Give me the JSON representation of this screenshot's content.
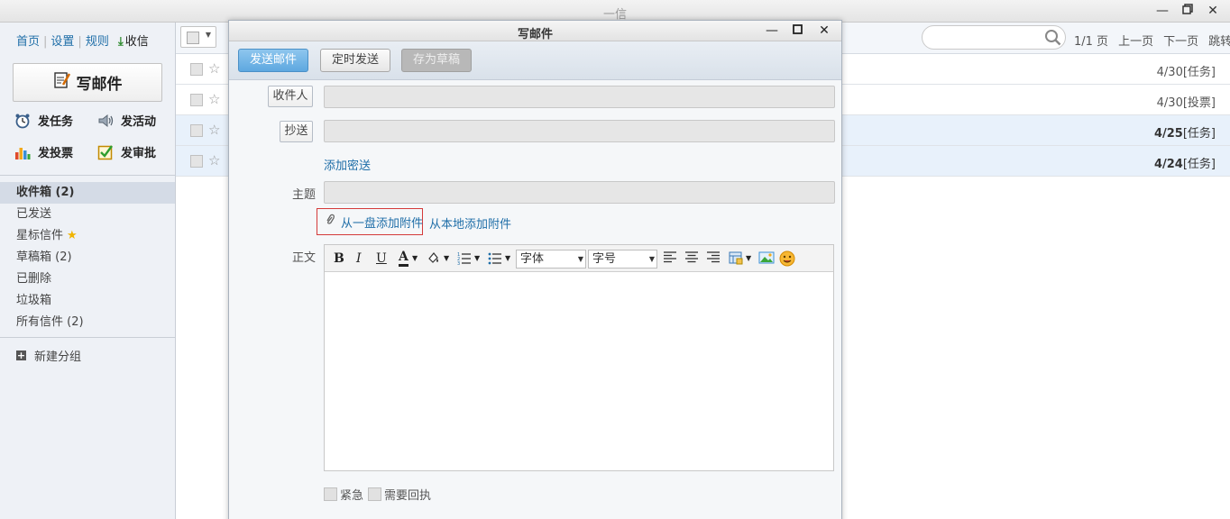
{
  "window": {
    "title": "一信"
  },
  "sidebar": {
    "toplinks": [
      "首页",
      "设置",
      "规则"
    ],
    "receive_label": "收信",
    "compose_label": "写邮件",
    "quick_actions": [
      {
        "label": "发任务",
        "icon": "alarm-clock-icon"
      },
      {
        "label": "发活动",
        "icon": "speaker-icon"
      },
      {
        "label": "发投票",
        "icon": "bar-chart-icon"
      },
      {
        "label": "发审批",
        "icon": "checkbox-check-icon"
      }
    ],
    "folders": [
      {
        "label": "收件箱 (2)",
        "active": true
      },
      {
        "label": "已发送"
      },
      {
        "label": "星标信件"
      },
      {
        "label": "草稿箱 (2)"
      },
      {
        "label": "已删除"
      },
      {
        "label": "垃圾箱"
      },
      {
        "label": "所有信件 (2)"
      }
    ],
    "new_group_label": "新建分组"
  },
  "list": {
    "pager": {
      "page_info": "1/1 页",
      "prev": "上一页",
      "next": "下一页",
      "jump": "跳转"
    },
    "rows": [
      {
        "date": "4/30",
        "tag": "[任务]",
        "unread": false
      },
      {
        "date": "4/30",
        "tag": "[投票]",
        "unread": false
      },
      {
        "date": "4/25",
        "tag": "[任务]",
        "unread": true
      },
      {
        "date": "4/24",
        "tag": "[任务]",
        "unread": true
      }
    ]
  },
  "compose": {
    "title": "写邮件",
    "toolbar": {
      "send": "发送邮件",
      "timed_send": "定时发送",
      "save_draft": "存为草稿"
    },
    "to_label": "收件人",
    "cc_label": "抄送",
    "add_bcc": "添加密送",
    "subject_label": "主题",
    "attach_cloud": "从一盘添加附件",
    "attach_local": "从本地添加附件",
    "body_label": "正文",
    "editor": {
      "font_family": "字体",
      "font_size": "字号"
    },
    "urgent_label": "紧急",
    "receipt_label": "需要回执"
  },
  "colors": {
    "accent": "#1f6ea8",
    "send_button": "#5ea8e0",
    "highlight_border": "#d43a3a"
  }
}
